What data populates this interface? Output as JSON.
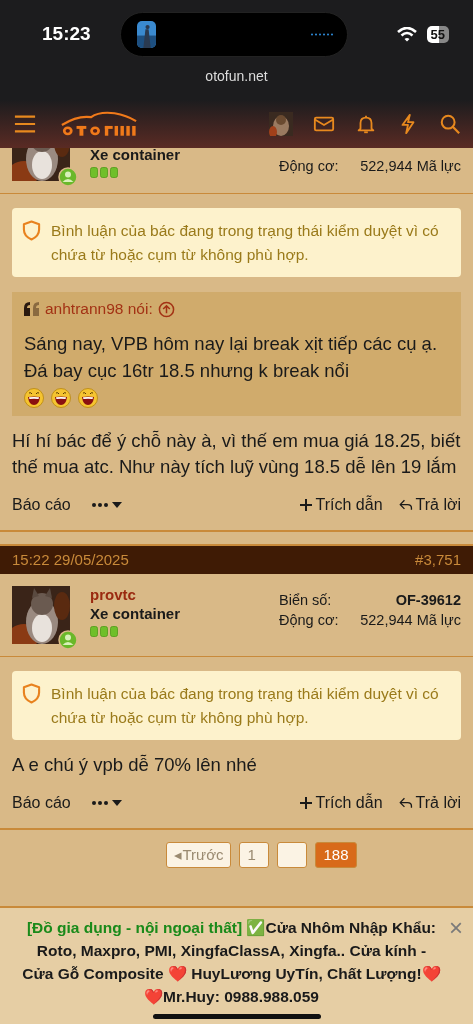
{
  "status_bar": {
    "time": "15:23",
    "battery": "55",
    "url": "otofun.net"
  },
  "posts": [
    {
      "cropped_top": true,
      "user_title": "Xe container",
      "online": true,
      "stats": [
        {
          "label": "Động cơ:",
          "value": "522,944 Mã lực",
          "bold": false
        }
      ],
      "notice": "Bình luận của bác đang trong trạng thái kiểm duyệt vì có chứa từ hoặc cụm từ không phù hợp.",
      "quote": {
        "author": "anhtrann98 nói:",
        "text": "Sáng nay, VPB hôm nay lại break xịt tiếp các cụ ạ. Đá bay cục 16tr 18.5 nhưng k break nổi"
      },
      "body": "Hí hí bác để ý chỗ này à, vì thế em mua giá 18.25, biết thế mua atc. Như này tích luỹ vùng 18.5 dễ lên 19 lắm",
      "actions": {
        "report": "Báo cáo",
        "quote": "Trích dẫn",
        "reply": "Trả lời"
      }
    },
    {
      "cropped_top": false,
      "date": "15:22 29/05/2025",
      "number": "#3,751",
      "username": "provtc",
      "user_title": "Xe container",
      "online": true,
      "stats": [
        {
          "label": "Biển số:",
          "value": "OF-39612",
          "bold": true
        },
        {
          "label": "Động cơ:",
          "value": "522,944 Mã lực",
          "bold": false
        }
      ],
      "notice": "Bình luận của bác đang trong trạng thái kiểm duyệt vì có chứa từ hoặc cụm từ không phù hợp.",
      "body": "A e chú ý vpb dễ 70% lên nhé",
      "actions": {
        "report": "Báo cáo",
        "quote": "Trích dẫn",
        "reply": "Trả lời"
      }
    }
  ],
  "pagination": [
    {
      "label": "◂Trước",
      "selected": false
    },
    {
      "label": "1",
      "selected": false
    },
    {
      "selected": false
    },
    {
      "label": "188",
      "selected": true
    }
  ],
  "ad": {
    "category": "[Đồ gia dụng - nội ngoại thất]",
    "text": "✅Cửa Nhôm Nhập Khẩu: Roto, Maxpro, PMI, XingfaClassA, Xingfa.. Cửa kính - Cửa Gỗ Composite ❤️ HuyLương UyTín, Chất Lượng!❤️❤️Mr.Huy: 0988.988.059",
    "close": "×"
  }
}
